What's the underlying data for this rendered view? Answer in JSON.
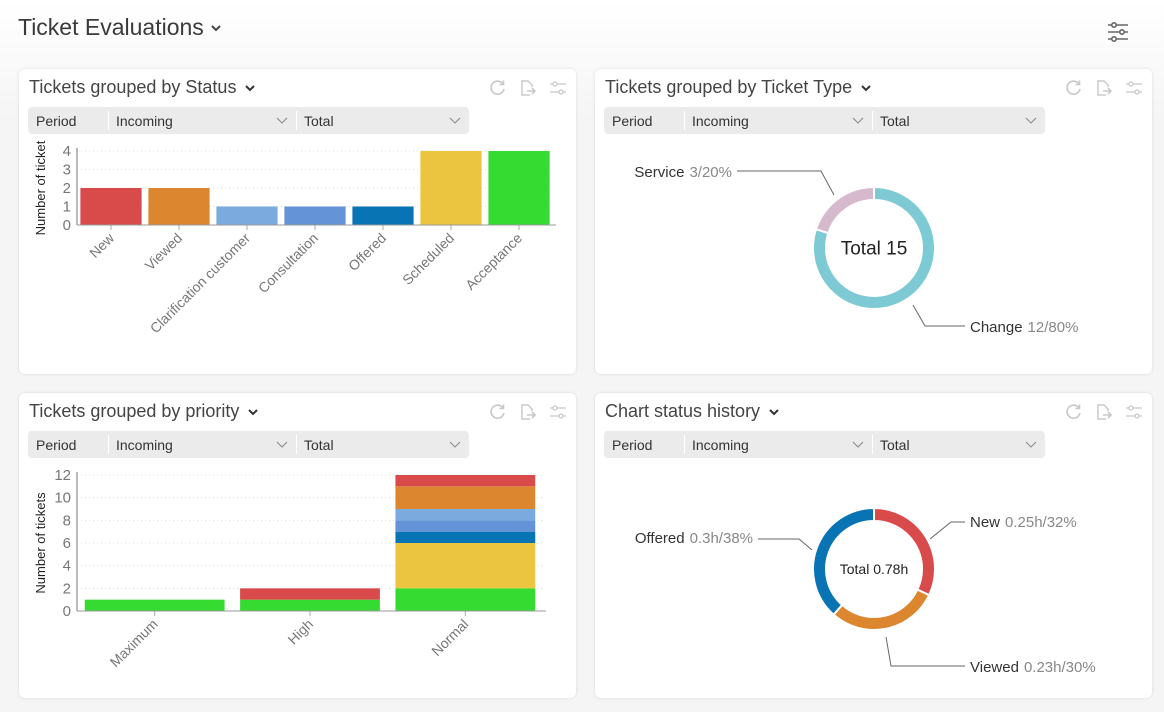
{
  "page": {
    "title": "Ticket Evaluations"
  },
  "filters": {
    "period_label": "Period",
    "incoming_label": "Incoming",
    "total_label": "Total"
  },
  "colors": {
    "New": "#d94b4b",
    "Viewed": "#dc8630",
    "Clarification customer": "#7aaade",
    "Consultation": "#6593d8",
    "Offered": "#0874b4",
    "Scheduled": "#ebc540",
    "Acceptance": "#35db30",
    "Service": "#d7b9cd",
    "Change": "#7ecad4"
  },
  "cards": [
    {
      "title": "Tickets grouped  by Status"
    },
    {
      "title": "Tickets grouped  by Ticket Type"
    },
    {
      "title": "Tickets grouped  by priority"
    },
    {
      "title": "Chart status history"
    }
  ],
  "chart_data": [
    {
      "type": "bar",
      "title": "Tickets grouped by Status",
      "xlabel": "",
      "ylabel": "Number of ticket",
      "categories": [
        "New",
        "Viewed",
        "Clarification customer",
        "Consultation",
        "Offered",
        "Scheduled",
        "Acceptance"
      ],
      "values": [
        2,
        2,
        1,
        1,
        1,
        4,
        4
      ],
      "yticks": [
        "0",
        "1",
        "2",
        "3",
        "4"
      ],
      "ylim": [
        0,
        4
      ],
      "grid": true
    },
    {
      "type": "pie",
      "title": "Tickets grouped by Ticket Type",
      "center_label": "Total 15",
      "slices": [
        {
          "name": "Change",
          "value": 12,
          "detail": "12/80%"
        },
        {
          "name": "Service",
          "value": 3,
          "detail": "3/20%"
        }
      ]
    },
    {
      "type": "bar",
      "stacked": true,
      "title": "Tickets grouped by priority",
      "xlabel": "",
      "ylabel": "Number of tickets",
      "categories": [
        "Maximum",
        "High",
        "Normal"
      ],
      "yticks": [
        "0",
        "2",
        "4",
        "6",
        "8",
        "10",
        "12"
      ],
      "ylim": [
        0,
        12
      ],
      "grid": true,
      "series": [
        {
          "name": "Acceptance",
          "values": [
            1,
            1,
            2
          ]
        },
        {
          "name": "Scheduled",
          "values": [
            0,
            0,
            4
          ]
        },
        {
          "name": "Offered",
          "values": [
            0,
            0,
            1
          ]
        },
        {
          "name": "Consultation",
          "values": [
            0,
            0,
            1
          ]
        },
        {
          "name": "Clarification customer",
          "values": [
            0,
            0,
            1
          ]
        },
        {
          "name": "Viewed",
          "values": [
            0,
            0,
            2
          ]
        },
        {
          "name": "New",
          "values": [
            0,
            1,
            1
          ]
        }
      ]
    },
    {
      "type": "pie",
      "title": "Chart status history",
      "center_label": "Total 0.78h",
      "slices": [
        {
          "name": "New",
          "value": 0.25,
          "detail": "0.25h/32%"
        },
        {
          "name": "Viewed",
          "value": 0.23,
          "detail": "0.23h/30%"
        },
        {
          "name": "Offered",
          "value": 0.3,
          "detail": "0.3h/38%"
        }
      ]
    }
  ]
}
